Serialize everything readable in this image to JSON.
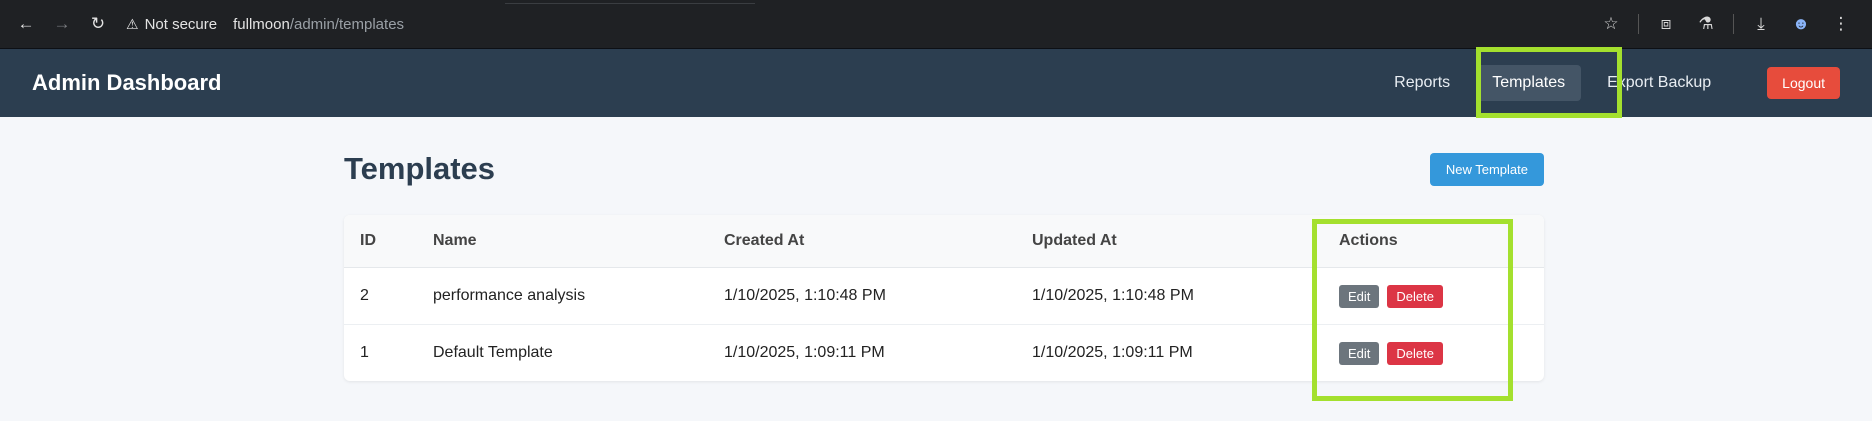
{
  "browser": {
    "security_label": "Not secure",
    "url_host": "fullmoon",
    "url_path": "/admin/templates",
    "icons": [
      "back-arrow-icon",
      "forward-arrow-icon",
      "reload-icon",
      "warning-icon",
      "star-icon",
      "extensions-icon",
      "labs-flask-icon",
      "download-icon",
      "profile-icon"
    ]
  },
  "header": {
    "title": "Admin Dashboard",
    "nav": [
      {
        "label": "Reports"
      },
      {
        "label": "Templates",
        "active": true
      },
      {
        "label": "Export Backup"
      }
    ],
    "logout_label": "Logout"
  },
  "main": {
    "title": "Templates",
    "new_button_label": "New Template",
    "table": {
      "columns": [
        "ID",
        "Name",
        "Created At",
        "Updated At",
        "Actions"
      ],
      "rows": [
        {
          "id": "2",
          "name": "performance analysis",
          "created": "1/10/2025, 1:10:48 PM",
          "updated": "1/10/2025, 1:10:48 PM",
          "edit": "Edit",
          "delete": "Delete"
        },
        {
          "id": "1",
          "name": "Default Template",
          "created": "1/10/2025, 1:09:11 PM",
          "updated": "1/10/2025, 1:09:11 PM",
          "edit": "Edit",
          "delete": "Delete"
        }
      ]
    }
  },
  "colors": {
    "header_bg": "#2c3e50",
    "primary": "#3498db",
    "danger": "#dc3545",
    "logout": "#e74c3c",
    "highlight": "#a4e02e"
  }
}
